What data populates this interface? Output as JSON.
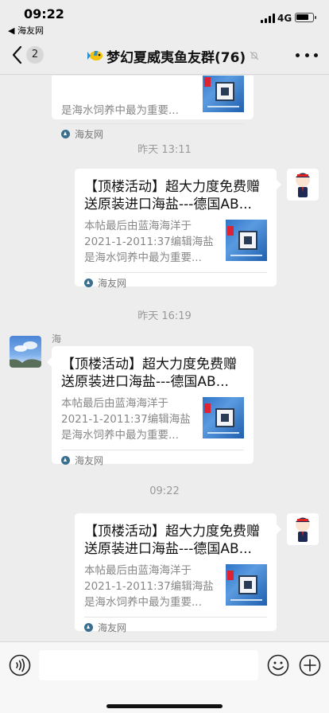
{
  "status_bar": {
    "time": "09:22",
    "back_app": "◀ 海友网",
    "network": "4G"
  },
  "nav": {
    "unread_count": "2",
    "title": "梦幻夏威夷鱼友群(76)"
  },
  "messages": [
    {
      "title": "",
      "description": "是海水饲养中最为重要...",
      "source": "海友网"
    },
    {
      "timestamp": "昨天 13:11",
      "title": "【顶楼活动】超大力度免费赠送原装进口海盐---德国AB...",
      "description": "本帖最后由蓝海海洋于2021-1-2011:37编辑海盐是海水饲养中最为重要...",
      "source": "海友网"
    },
    {
      "timestamp": "昨天 16:19",
      "sender": "海",
      "title": "【顶楼活动】超大力度免费赠送原装进口海盐---德国AB...",
      "description": "本帖最后由蓝海海洋于2021-1-2011:37编辑海盐是海水饲养中最为重要...",
      "source": "海友网"
    },
    {
      "timestamp": "09:22",
      "title": "【顶楼活动】超大力度免费赠送原装进口海盐---德国AB...",
      "description": "本帖最后由蓝海海洋于2021-1-2011:37编辑海盐是海水饲养中最为重要...",
      "source": "海友网"
    }
  ],
  "input": {
    "value": "",
    "placeholder": ""
  },
  "icons": {
    "back": "chevron-left-icon",
    "fish": "fish-icon",
    "mute": "mute-bell-icon",
    "more": "more-dots-icon",
    "voice": "voice-icon",
    "emoji": "emoji-icon",
    "plus": "plus-icon"
  },
  "colors": {
    "background": "#ededed",
    "bubble": "#ffffff",
    "timestamp": "#9a9a9a"
  }
}
